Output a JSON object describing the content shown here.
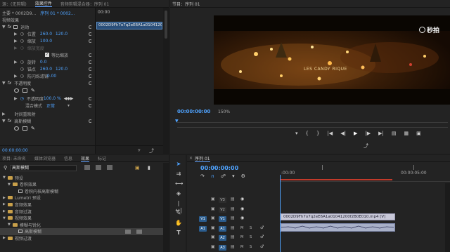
{
  "top_tabs": {
    "source": "源：(无剪辑)",
    "effect_controls": "效果控件",
    "audio_mixer": "音频剪辑混合器：序列 01",
    "program": "节目：序列 01"
  },
  "effect_controls": {
    "master_clip": "主要 * 0002D9...",
    "sequence_clip": "序列 01 * 0002...",
    "clip_header": "0002D9Fh7o7q2eE6A1a01041200",
    "timeline_time": "00:00",
    "video_effects_label": "视频效果",
    "motion": "运动",
    "position_label": "位置",
    "position_x": "260.0",
    "position_y": "120.0",
    "scale_label": "缩放",
    "scale_value": "100.0",
    "scale_width_label": "缩放宽度",
    "uniform_scale_label": "等比缩放",
    "rotation_label": "旋转",
    "rotation_value": "0.0",
    "anchor_label": "锚点",
    "anchor_x": "260.0",
    "anchor_y": "120.0",
    "antiflicker_label": "防闪烁滤镜",
    "antiflicker_value": "0.00",
    "opacity": "不透明度",
    "opacity_label": "不透明度",
    "opacity_value": "100.0 %",
    "blend_label": "混合模式",
    "blend_value": "正常",
    "time_remap": "时间重映射",
    "gaussian_blur": "高斯模糊",
    "footer_time": "00:00:00:00"
  },
  "program": {
    "watermark": "秒拍",
    "subtitle": "LES CANDY RIQUE",
    "timecode": "00:00:00:00",
    "zoom": "150%"
  },
  "project_panel": {
    "tabs": [
      "项目: 未命名",
      "媒体浏览器",
      "信息",
      "效果",
      "标记"
    ],
    "search_value": "高斯模糊",
    "items": [
      {
        "label": "预设",
        "level": 0,
        "type": "folder"
      },
      {
        "label": "卷积效果",
        "level": 1,
        "type": "folder"
      },
      {
        "label": "卷积内核高斯模糊",
        "level": 2,
        "type": "item"
      },
      {
        "label": "Lumetri 预设",
        "level": 0,
        "type": "folder"
      },
      {
        "label": "音频效果",
        "level": 0,
        "type": "folder"
      },
      {
        "label": "音频过渡",
        "level": 0,
        "type": "folder"
      },
      {
        "label": "视频效果",
        "level": 0,
        "type": "folder"
      },
      {
        "label": "模糊与锐化",
        "level": 1,
        "type": "folder"
      },
      {
        "label": "高斯模糊",
        "level": 2,
        "type": "item"
      },
      {
        "label": "视频过渡",
        "level": 0,
        "type": "folder"
      }
    ]
  },
  "timeline": {
    "tab": "序列 01",
    "timecode": "00:00:00:00",
    "ruler_start": ":00:00",
    "ruler_mark": "00:00:05:00",
    "tracks": [
      "V3",
      "V2",
      "V1",
      "A1",
      "A2",
      "A3"
    ],
    "clip_name": "0002D9Fh7o7q2eE6A1a01041200f2B0E010.mp4 [V]"
  }
}
